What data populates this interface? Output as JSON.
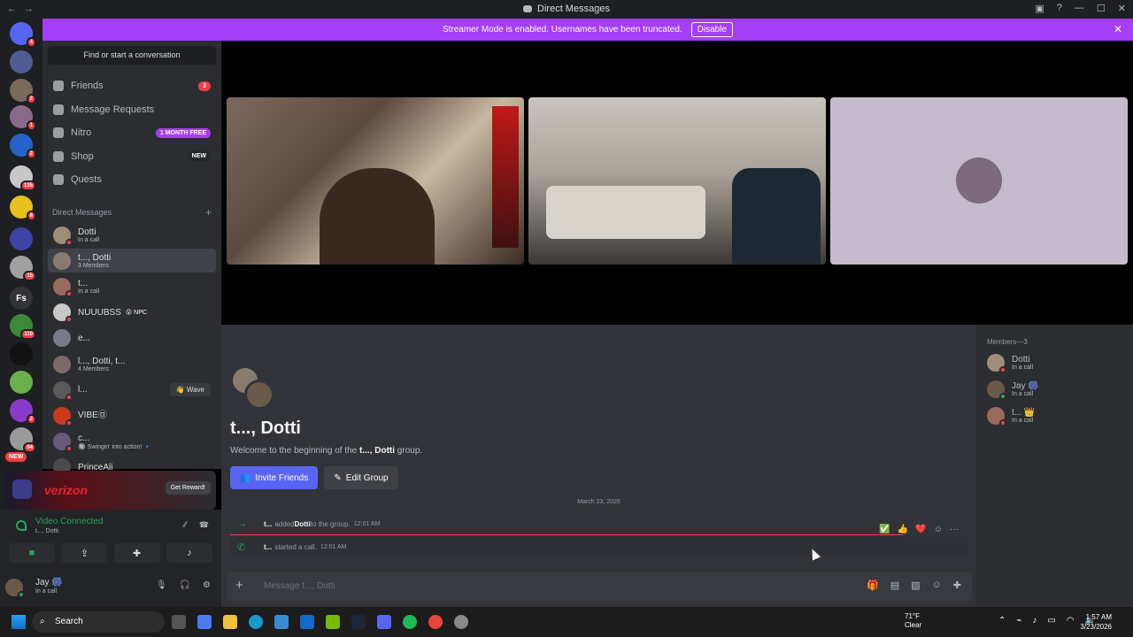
{
  "window": {
    "title": "Direct Messages"
  },
  "banner": {
    "text": "Streamer Mode is enabled. Usernames have been truncated.",
    "button": "Disable"
  },
  "servers": {
    "items": [
      {
        "name": "home-icon",
        "badge": "4",
        "color": "#5865f2"
      },
      {
        "name": "server-2",
        "badge": "",
        "color": "#4e5d94"
      },
      {
        "name": "server-3",
        "badge": "2",
        "color": "#7a6a5a"
      },
      {
        "name": "server-4",
        "badge": "1",
        "color": "#8a6a8a"
      },
      {
        "name": "server-5",
        "badge": "2",
        "color": "#2563c9"
      },
      {
        "name": "server-6",
        "badge": "135",
        "color": "#c8c8c8"
      },
      {
        "name": "server-7",
        "badge": "8",
        "color": "#e8c020"
      },
      {
        "name": "folder",
        "badge": "",
        "color": "#3c45a5"
      },
      {
        "name": "server-9",
        "badge": "15",
        "color": "#a0a0a0"
      },
      {
        "name": "server-fs",
        "badge": "",
        "color": "#313338",
        "label": "Fs"
      },
      {
        "name": "server-11",
        "badge": "110",
        "color": "#3a8a3a"
      },
      {
        "name": "server-12",
        "badge": "",
        "color": "#111111"
      },
      {
        "name": "server-13",
        "badge": "",
        "color": "#6ab04c"
      },
      {
        "name": "server-14",
        "badge": "2",
        "color": "#8a3ac8"
      },
      {
        "name": "server-15",
        "badge": "94",
        "color": "#9a9a9a"
      }
    ],
    "new_badge": "NEW"
  },
  "sidebar": {
    "find": "Find or start a conversation",
    "nav": [
      {
        "label": "Friends",
        "pill": "3",
        "pill_color": "#f23f43"
      },
      {
        "label": "Message Requests",
        "pill": "",
        "pill_color": ""
      },
      {
        "label": "Nitro",
        "pill": "1 MONTH FREE",
        "pill_color": "#a43ef8"
      },
      {
        "label": "Shop",
        "pill": "NEW",
        "pill_color": "#23262a"
      },
      {
        "label": "Quests",
        "pill": "",
        "pill_color": ""
      }
    ],
    "dm_header": "Direct Messages",
    "dms": [
      {
        "name": "Dotti",
        "sub": "In a call",
        "color": "#a08c7a"
      },
      {
        "name": "t..., Dotti",
        "sub": "3 Members",
        "color": "#8a7b70"
      },
      {
        "name": "t...",
        "sub": "In a call",
        "color": "#9a6a5a"
      },
      {
        "name": "NUUUBSS",
        "sub": "",
        "tag": "😮 NPC",
        "color": "#c8c8c8"
      },
      {
        "name": "e...",
        "sub": "",
        "color": "#7a7a8a"
      },
      {
        "name": "l..., Dotti, t...",
        "sub": "4 Members",
        "color": "#7a6a6a"
      },
      {
        "name": "l...",
        "sub": "",
        "wave": "👋 Wave",
        "color": "#5a5a5a"
      },
      {
        "name": "VIBE㉤",
        "sub": "",
        "color": "#c83a1a"
      },
      {
        "name": "c...",
        "sub": "🔘 Swingin' into action! 🔹",
        "color": "#6a5a7a"
      },
      {
        "name": "PrinceAli",
        "sub": "",
        "color": "#4a4a4a"
      }
    ]
  },
  "ad": {
    "brand": "verizon",
    "button": "Get Reward!"
  },
  "voice": {
    "status": "Video Connected",
    "channel": "t..., Dotti"
  },
  "user": {
    "name": "Jay 🎆",
    "status": "In a call"
  },
  "group": {
    "title": "t..., Dotti",
    "welcome_prefix": "Welcome to the beginning of the ",
    "welcome_name": "t..., Dotti",
    "welcome_suffix": " group.",
    "invite": "Invite Friends",
    "edit": "Edit Group"
  },
  "messages": {
    "date": "March 23, 2026",
    "items": [
      {
        "actor": "t...",
        "text1": " added ",
        "target": "Dotti",
        "text2": " to the group.",
        "time": "12:01 AM"
      },
      {
        "actor": "t...",
        "text1": " started a call.",
        "target": "",
        "text2": "",
        "time": "12:01 AM"
      }
    ]
  },
  "composer": {
    "placeholder": "Message t..., Dotti"
  },
  "members": {
    "header": "Members—3",
    "items": [
      {
        "name": "Dotti",
        "sub": "In a call",
        "color": "#a08c7a"
      },
      {
        "name": "Jay 🎆",
        "sub": "In a call",
        "color": "#6a5a4a"
      },
      {
        "name": "t... 👑",
        "sub": "In a call",
        "color": "#9a6a5a"
      }
    ]
  },
  "taskbar": {
    "search": "Search",
    "temp": "71°F",
    "weather": "Clear",
    "time": "1:57 AM",
    "date": "3/23/2026"
  }
}
